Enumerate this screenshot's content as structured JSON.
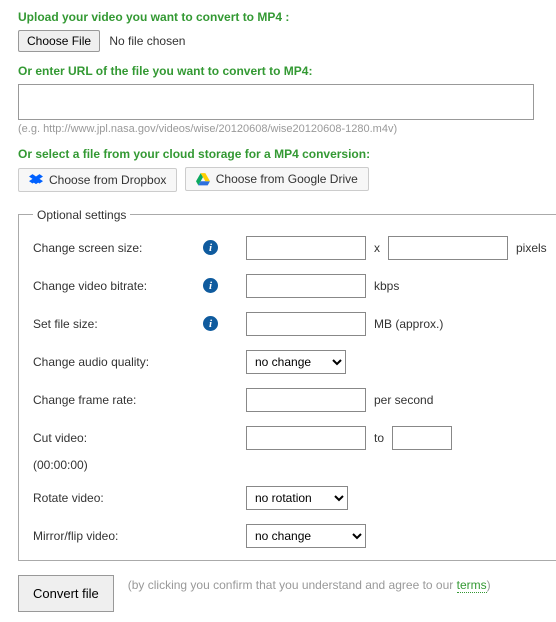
{
  "upload": {
    "heading": "Upload your video you want to convert to MP4 :",
    "button": "Choose File",
    "status": "No file chosen"
  },
  "url": {
    "heading": "Or enter URL of the file you want to convert to MP4:",
    "example": "(e.g. http://www.jpl.nasa.gov/videos/wise/20120608/wise20120608-1280.m4v)"
  },
  "cloud": {
    "heading": "Or select a file from your cloud storage for a MP4 conversion:",
    "dropbox": "Choose from Dropbox",
    "gdrive": "Choose from Google Drive"
  },
  "settings": {
    "legend": "Optional settings",
    "screen_size": {
      "label": "Change screen size:",
      "sep": "x",
      "unit": "pixels"
    },
    "bitrate": {
      "label": "Change video bitrate:",
      "unit": "kbps"
    },
    "filesize": {
      "label": "Set file size:",
      "unit": "MB (approx.)"
    },
    "audio": {
      "label": "Change audio quality:",
      "selected": "no change"
    },
    "framerate": {
      "label": "Change frame rate:",
      "unit": "per second"
    },
    "cut": {
      "label": "Cut video:",
      "sep": "to",
      "note": "(00:00:00)"
    },
    "rotate": {
      "label": "Rotate video:",
      "selected": "no rotation"
    },
    "mirror": {
      "label": "Mirror/flip video:",
      "selected": "no change"
    }
  },
  "submit": {
    "button": "Convert file",
    "text_before": "(by clicking you confirm that you understand and agree to our ",
    "terms": "terms",
    "text_after": ")"
  }
}
